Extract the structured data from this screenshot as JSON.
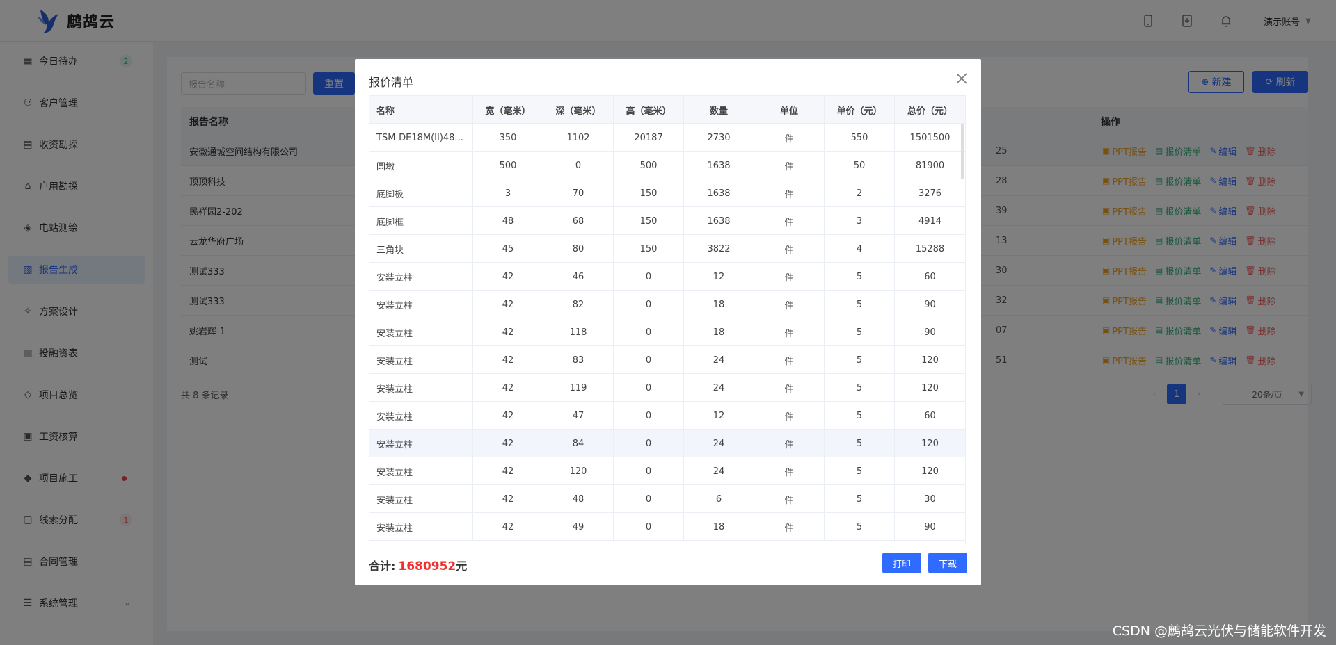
{
  "app": {
    "brand": "鹧鸪云",
    "account": "演示账号"
  },
  "sidebar": {
    "items": [
      {
        "label": "今日待办",
        "icon": "calendar-todo-icon",
        "badge": "2",
        "badge_color": "green"
      },
      {
        "label": "客户管理",
        "icon": "users-icon"
      },
      {
        "label": "收资勘探",
        "icon": "clipboard-icon"
      },
      {
        "label": "户用勘探",
        "icon": "home-icon"
      },
      {
        "label": "电站测绘",
        "icon": "survey-icon"
      },
      {
        "label": "报告生成",
        "icon": "report-icon",
        "active": true
      },
      {
        "label": "方案设计",
        "icon": "design-icon"
      },
      {
        "label": "投融资表",
        "icon": "finance-icon"
      },
      {
        "label": "项目总览",
        "icon": "layers-icon"
      },
      {
        "label": "工资核算",
        "icon": "salary-icon"
      },
      {
        "label": "项目施工",
        "icon": "construction-icon",
        "dot": true
      },
      {
        "label": "线索分配",
        "icon": "clue-icon",
        "badge": "1",
        "badge_color": "red"
      },
      {
        "label": "合同管理",
        "icon": "contract-icon"
      },
      {
        "label": "系统管理",
        "icon": "settings-icon",
        "expandable": true
      }
    ]
  },
  "toolbar": {
    "search_placeholder": "报告名称",
    "reset_label": "重置",
    "new_label": "新建",
    "refresh_label": "刷新"
  },
  "report_table": {
    "headers": {
      "name": "报告名称",
      "ops": "操作"
    },
    "rows": [
      {
        "name": "安徽通城空间结构有限公司",
        "tail": "25"
      },
      {
        "name": "顶顶科技",
        "tail": "28"
      },
      {
        "name": "民祥园2-202",
        "tail": "39"
      },
      {
        "name": "云龙华府广场",
        "tail": "13"
      },
      {
        "name": "测试333",
        "tail": "30"
      },
      {
        "name": "测试333",
        "tail": "32"
      },
      {
        "name": "姚岩辉-1",
        "tail": "07"
      },
      {
        "name": "测试",
        "tail": "51"
      }
    ],
    "ops": {
      "ppt": "PPT报告",
      "quote": "报价清单",
      "edit": "编辑",
      "delete": "删除"
    },
    "total_records": "共 8 条记录",
    "page": "1",
    "page_size": "20条/页"
  },
  "modal": {
    "title": "报价清单",
    "headers": [
      "名称",
      "宽（毫米）",
      "深（毫米）",
      "高（毫米）",
      "数量",
      "单位",
      "单价（元）",
      "总价（元）"
    ],
    "rows": [
      [
        "TSM-DE18M(II)48...",
        "350",
        "1102",
        "20187",
        "2730",
        "件",
        "550",
        "1501500"
      ],
      [
        "圆墩",
        "500",
        "0",
        "500",
        "1638",
        "件",
        "50",
        "81900"
      ],
      [
        "底脚板",
        "3",
        "70",
        "150",
        "1638",
        "件",
        "2",
        "3276"
      ],
      [
        "底脚框",
        "48",
        "68",
        "150",
        "1638",
        "件",
        "3",
        "4914"
      ],
      [
        "三角块",
        "45",
        "80",
        "150",
        "3822",
        "件",
        "4",
        "15288"
      ],
      [
        "安装立柱",
        "42",
        "46",
        "0",
        "12",
        "件",
        "5",
        "60"
      ],
      [
        "安装立柱",
        "42",
        "82",
        "0",
        "18",
        "件",
        "5",
        "90"
      ],
      [
        "安装立柱",
        "42",
        "118",
        "0",
        "18",
        "件",
        "5",
        "90"
      ],
      [
        "安装立柱",
        "42",
        "83",
        "0",
        "24",
        "件",
        "5",
        "120"
      ],
      [
        "安装立柱",
        "42",
        "119",
        "0",
        "24",
        "件",
        "5",
        "120"
      ],
      [
        "安装立柱",
        "42",
        "47",
        "0",
        "12",
        "件",
        "5",
        "60"
      ],
      [
        "安装立柱",
        "42",
        "84",
        "0",
        "24",
        "件",
        "5",
        "120"
      ],
      [
        "安装立柱",
        "42",
        "120",
        "0",
        "24",
        "件",
        "5",
        "120"
      ],
      [
        "安装立柱",
        "42",
        "48",
        "0",
        "6",
        "件",
        "5",
        "30"
      ],
      [
        "安装立柱",
        "42",
        "49",
        "0",
        "18",
        "件",
        "5",
        "90"
      ]
    ],
    "highlight_row": 11,
    "total_label": "合计:",
    "total_value": "1680952",
    "total_unit": "元",
    "print_label": "打印",
    "download_label": "下载"
  },
  "watermark": "CSDN @鹧鸪云光伏与储能软件开发"
}
